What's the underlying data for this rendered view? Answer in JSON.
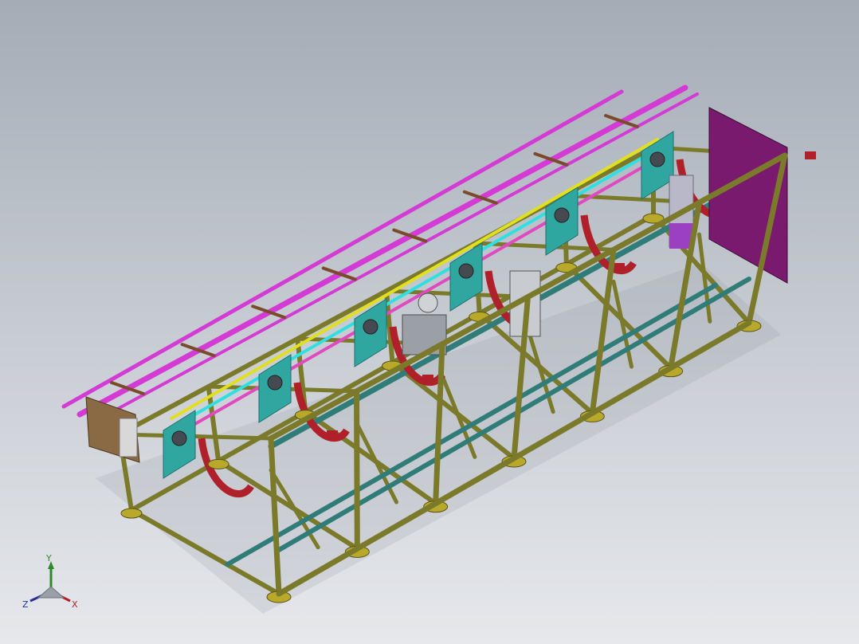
{
  "viewport": {
    "background_top": "#a5acb6",
    "background_bottom": "#e6e8ec"
  },
  "model": {
    "frame_color": "#7b7a2a",
    "crossbar_color": "#2f7c78",
    "rail_color": "#d43ad4",
    "plate_color": "#2fa7a0",
    "belt_color": "#b0202a",
    "shaft_colors": [
      "#e0e020",
      "#2fe0e0",
      "#e04ac0"
    ],
    "panel_color": "#7a1a6e",
    "foot_color": "#b9a92a"
  },
  "triad": {
    "x_label": "X",
    "y_label": "Y",
    "z_label": "Z",
    "x_color": "#b0202a",
    "y_color": "#2c8a2c",
    "z_color": "#2a2f9a"
  }
}
